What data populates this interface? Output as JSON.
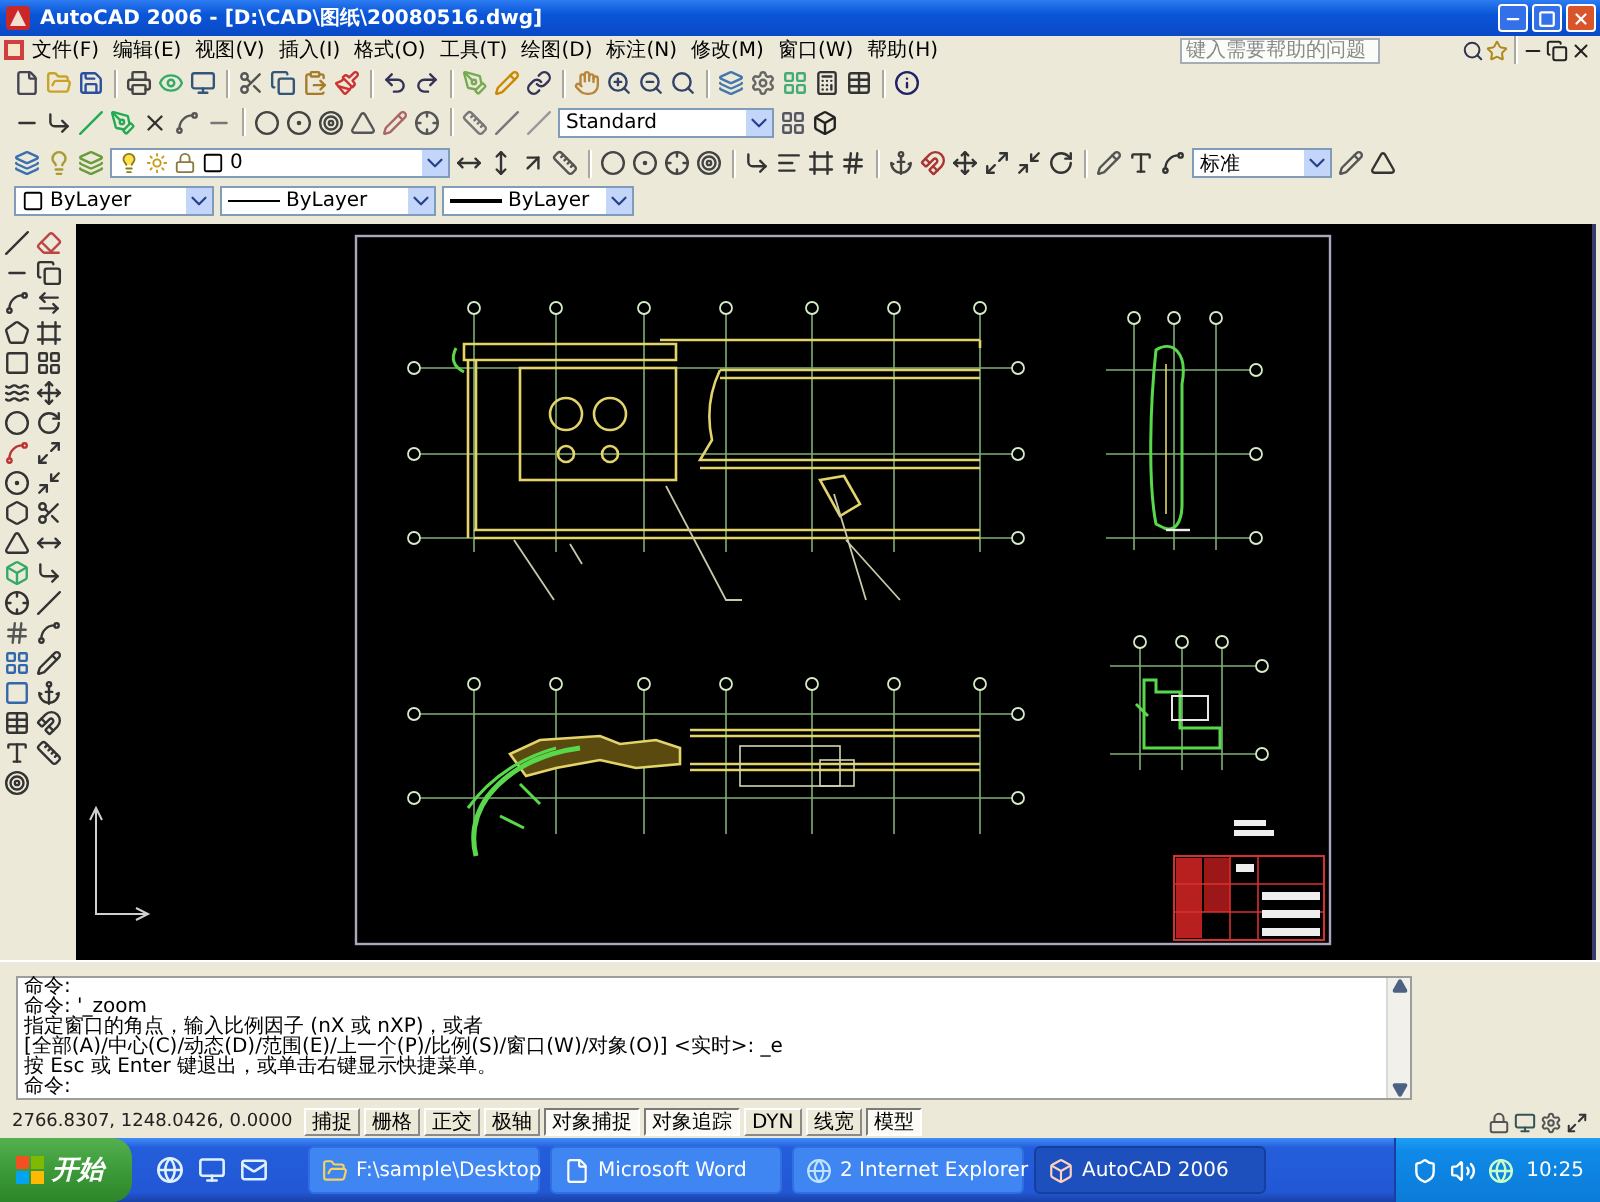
{
  "window": {
    "title": "AutoCAD 2006 - [D:\\CAD\\图纸\\20080516.dwg]"
  },
  "menu_bar": {
    "items": [
      "文件(F)",
      "编辑(E)",
      "视图(V)",
      "插入(I)",
      "格式(O)",
      "工具(T)",
      "绘图(D)",
      "标注(N)",
      "修改(M)",
      "窗口(W)",
      "帮助(H)"
    ],
    "help_search": {
      "placeholder": "键入需要帮助的问题"
    }
  },
  "styles_toolbar": {
    "text_style": "Standard"
  },
  "layers_toolbar": {
    "layer": "0"
  },
  "dimension_toolbar": {
    "dim_style": "标准"
  },
  "properties_toolbar": {
    "color_setting": "ByLayer",
    "linetype": "ByLayer",
    "lineweight": "ByLayer"
  },
  "command_window": {
    "lines": [
      "命令:",
      "命令: '_zoom",
      "指定窗口的角点，输入比例因子 (nX 或 nXP)，或者",
      "[全部(A)/中心(C)/动态(D)/范围(E)/上一个(P)/比例(S)/窗口(W)/对象(O)] <实时>: _e",
      "按 Esc 或 Enter 键退出，或单击右键显示快捷菜单。",
      "命令:"
    ]
  },
  "status_bar": {
    "coordinates": "2766.8307, 1248.0426, 0.0000",
    "toggles": [
      {
        "label": "捕捉",
        "on": false
      },
      {
        "label": "栅格",
        "on": false
      },
      {
        "label": "正交",
        "on": false
      },
      {
        "label": "极轴",
        "on": false
      },
      {
        "label": "对象捕捉",
        "on": true
      },
      {
        "label": "对象追踪",
        "on": true
      },
      {
        "label": "DYN",
        "on": false
      },
      {
        "label": "线宽",
        "on": false
      },
      {
        "label": "模型",
        "on": true
      }
    ]
  },
  "taskbar": {
    "start": "开始",
    "tasks": [
      {
        "label": "F:\\sample\\Desktop",
        "selected": false
      },
      {
        "label": "Microsoft Word",
        "selected": false
      },
      {
        "label": "2 Internet Explorer",
        "selected": false
      },
      {
        "label": "AutoCAD 2006",
        "selected": true
      }
    ],
    "clock": "10:25"
  }
}
